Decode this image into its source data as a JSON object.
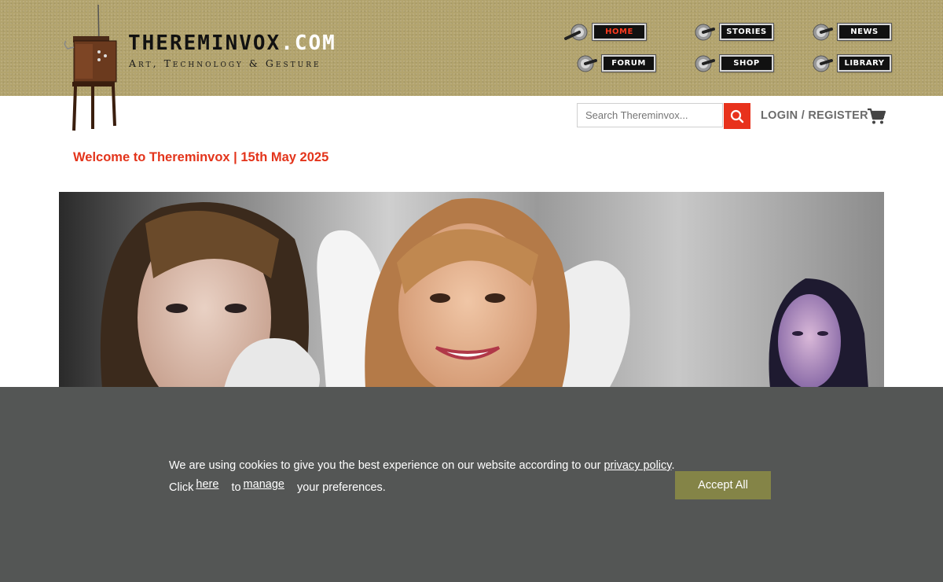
{
  "brand": {
    "name": "THEREMINVOX",
    "domain_suffix": ".COM",
    "tagline": "Art, Technology & Gesture"
  },
  "nav": {
    "items": [
      {
        "label": "HOME",
        "active": true
      },
      {
        "label": "STORIES",
        "active": false
      },
      {
        "label": "NEWS",
        "active": false
      },
      {
        "label": "FORUM",
        "active": false
      },
      {
        "label": "SHOP",
        "active": false
      },
      {
        "label": "LIBRARY",
        "active": false
      }
    ]
  },
  "search": {
    "placeholder": "Search Thereminvox..."
  },
  "account": {
    "login_label": "LOGIN / REGISTER"
  },
  "welcome": {
    "text": "Welcome to Thereminvox | 15th May 2025"
  },
  "cookie": {
    "line1_prefix": "We are using cookies to give you the best experience on our website according to our ",
    "privacy_link": "privacy policy",
    "line1_suffix": ".",
    "click_text": "Click",
    "here_link": "here",
    "to_text": "to",
    "manage_link": "manage",
    "preferences_text": "your preferences.",
    "accept_label": "Accept All"
  },
  "colors": {
    "header_bg": "#b3a46e",
    "accent_red": "#e3341b",
    "cookie_bg": "#545655",
    "accept_bg": "#848447"
  }
}
